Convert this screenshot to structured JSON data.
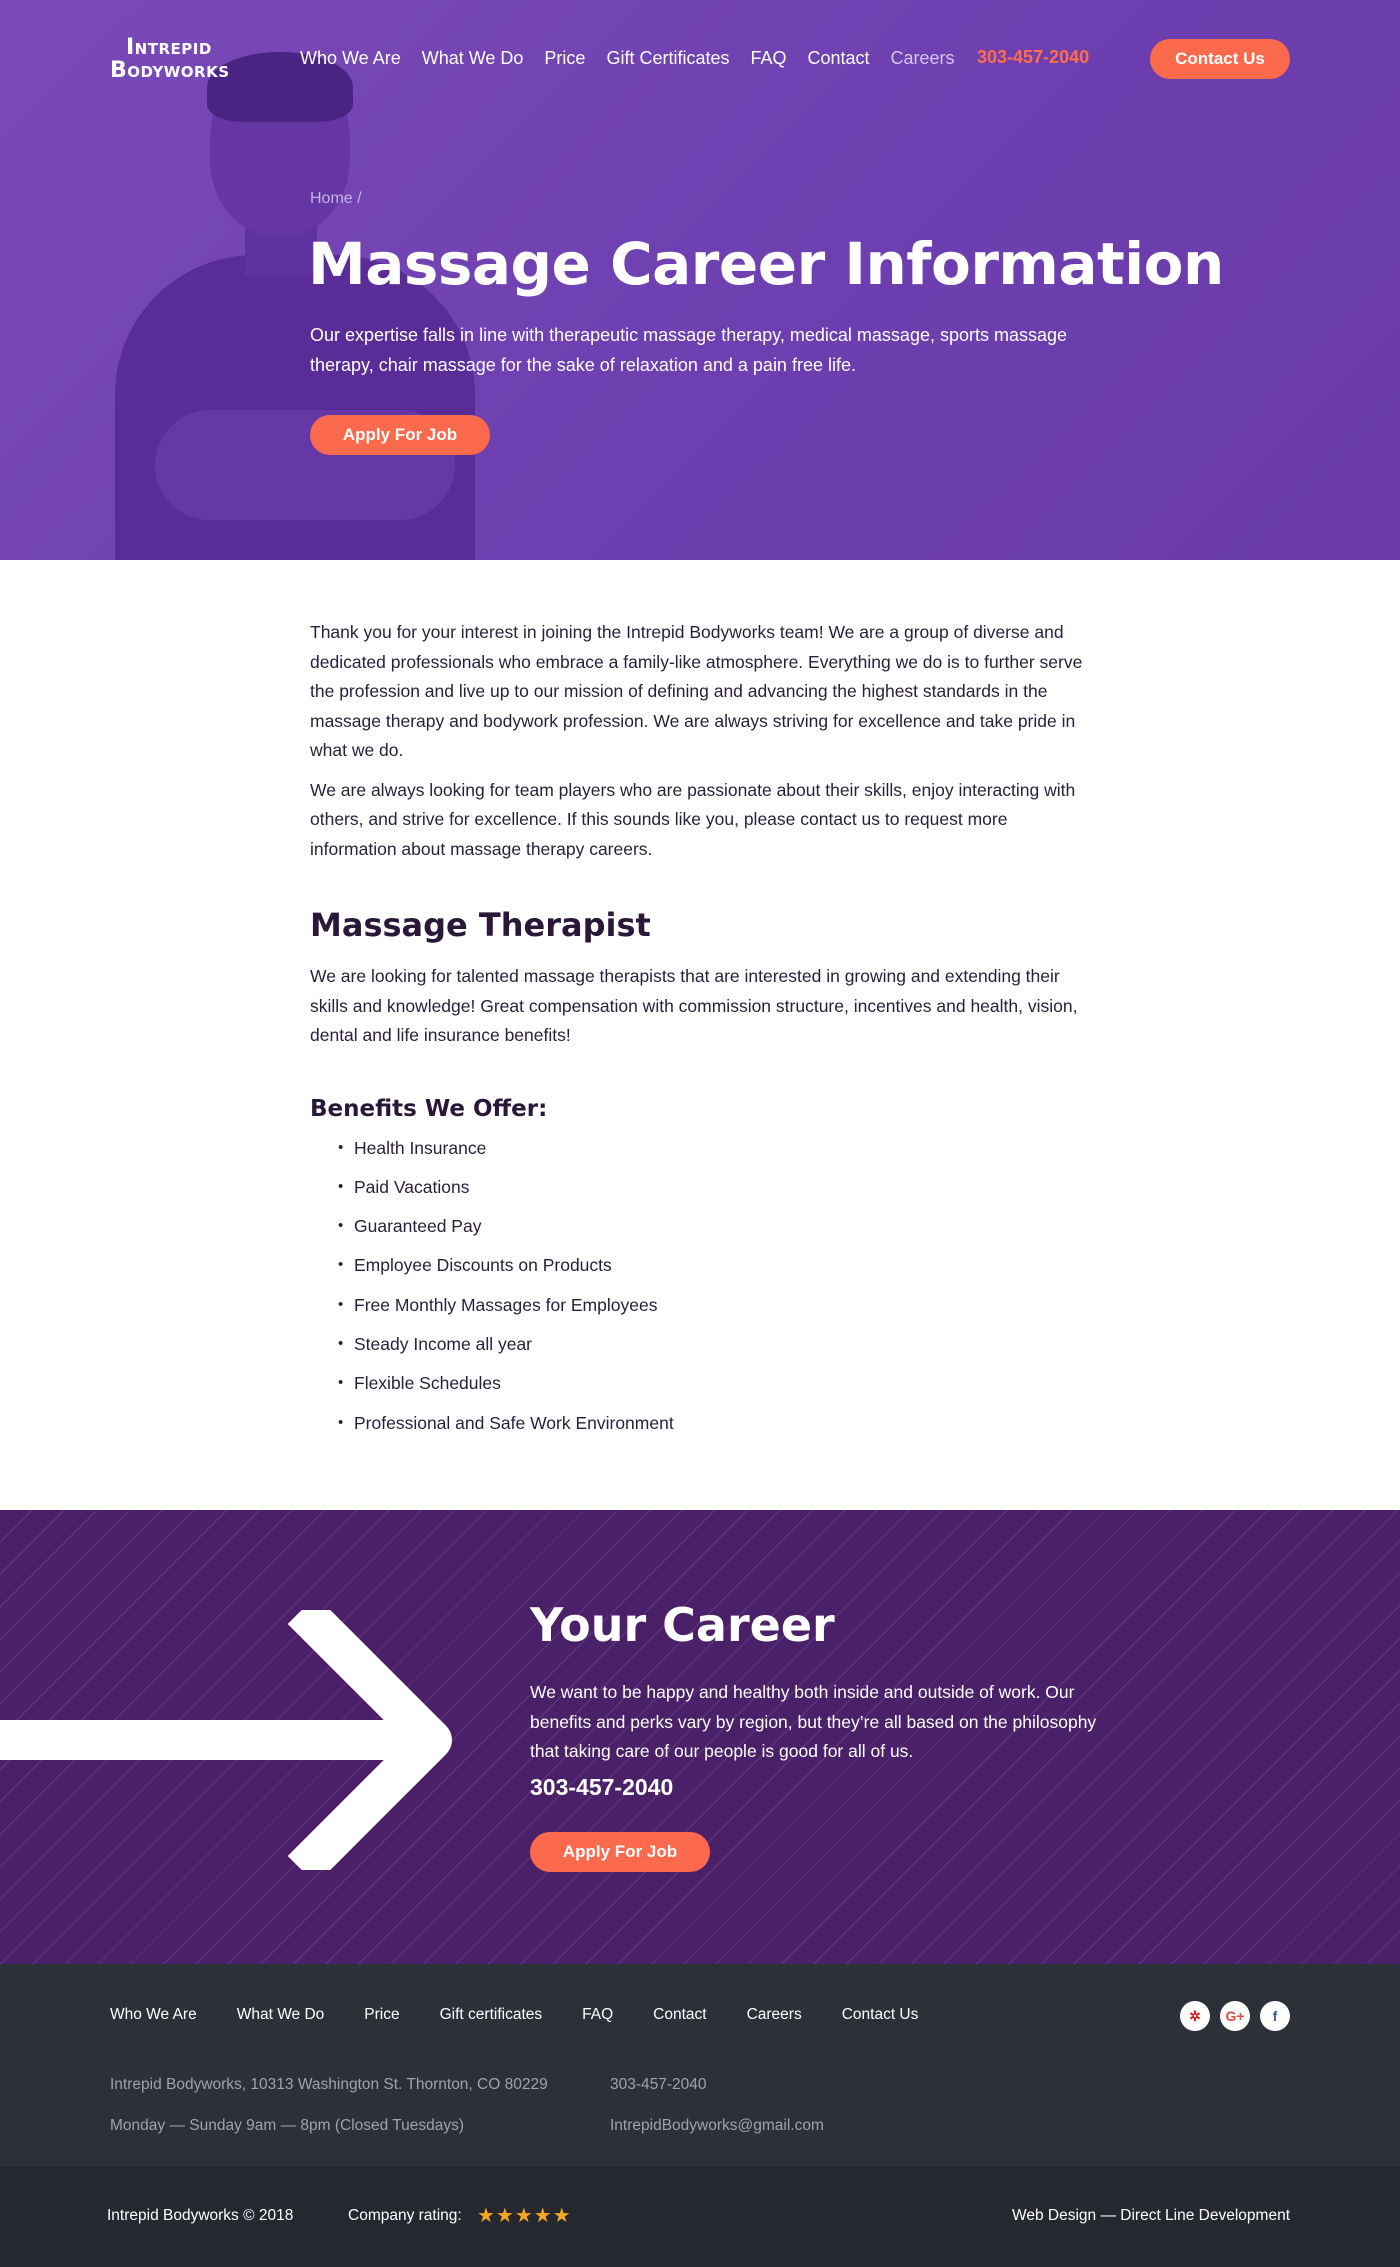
{
  "brand": {
    "logo_line1": "Intrepid",
    "logo_line2": "Bodyworks"
  },
  "nav": {
    "items": [
      "Who We Are",
      "What We Do",
      "Price",
      "Gift Certificates",
      "FAQ",
      "Contact",
      "Careers"
    ],
    "phone": "303-457-2040",
    "cta": "Contact Us"
  },
  "hero": {
    "breadcrumb": "Home /",
    "title": "Massage Career Information",
    "subtitle": "Our expertise falls in line with therapeutic massage therapy, medical massage, sports massage therapy, chair massage for the sake of relaxation and a pain free life.",
    "apply_label": "Apply For Job"
  },
  "content": {
    "intro": [
      "Thank you for your interest in joining the Intrepid Bodyworks team! We are a group of diverse and dedicated professionals who embrace a family-like atmosphere. Everything we do is to further serve the profession and live up to our mission of defining and advancing the highest standards in the massage therapy and bodywork profession. We are always striving for excellence and take pride in what we do.",
      "We are always looking for team players who are passionate about their skills, enjoy interacting with others, and strive for excellence. If this sounds like you, please contact us to request more information about massage therapy careers."
    ],
    "job_title": "Massage Therapist",
    "job_text": "We are looking for talented massage therapists that are interested in growing and extending their skills and knowledge! Great compensation with commission structure, incentives and health, vision, dental and life insurance benefits!",
    "benefits_title": "Benefits We Offer:",
    "benefits": [
      "Health Insurance",
      "Paid Vacations",
      "Guaranteed Pay",
      "Employee Discounts on Products",
      "Free Monthly Massages for Employees",
      "Steady Income all year",
      "Flexible Schedules",
      "Professional and Safe Work Environment"
    ]
  },
  "career": {
    "title": "Your Career",
    "text": "We want to be happy and healthy both inside and outside of work. Our benefits and perks vary by region, but they’re all based on the philosophy that taking care of our people is good for all of us.",
    "phone": "303-457-2040",
    "apply_label": "Apply For Job"
  },
  "footer": {
    "links": [
      "Who We Are",
      "What We Do",
      "Price",
      "Gift certificates",
      "FAQ",
      "Contact",
      "Careers",
      "Contact Us"
    ],
    "social": [
      {
        "icon": "yelp-icon",
        "glyph": "✲",
        "color": "#d32323"
      },
      {
        "icon": "google-plus-icon",
        "glyph": "G+",
        "color": "#dd4b39"
      },
      {
        "icon": "facebook-icon",
        "glyph": "f",
        "color": "#3b5998"
      }
    ],
    "address": "Intrepid Bodyworks, 10313 Washington St. Thornton, CO 80229",
    "hours": "Monday — Sunday 9am — 8pm (Closed Tuesdays)",
    "phone": "303-457-2040",
    "email": "IntrepidBodyworks@gmail.com"
  },
  "bottom": {
    "copyright": "Intrepid Bodyworks © 2018",
    "rating_label": "Company rating:",
    "rating_stars": 5,
    "credit": "Web Design — Direct Line Development"
  },
  "colors": {
    "hero_purple": "#7b4ab8",
    "accent": "#fb6a4c",
    "career_purple": "#4a2168",
    "footer": "#2c3039"
  }
}
